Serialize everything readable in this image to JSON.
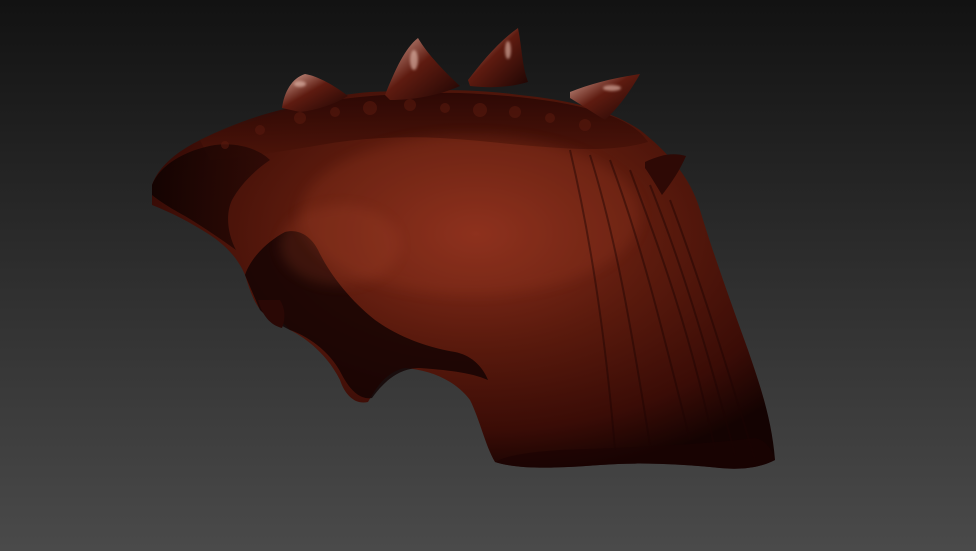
{
  "viewport": {
    "background_top_color": "#121212",
    "background_bottom_color": "#4a4a4a",
    "model": {
      "subject": "sculpted-shell-model",
      "base_color": "#3a0c06",
      "highlight_color": "#8a2e1c",
      "shadow_color": "#140302",
      "spike_highlight_color": "#d9a89a"
    }
  }
}
